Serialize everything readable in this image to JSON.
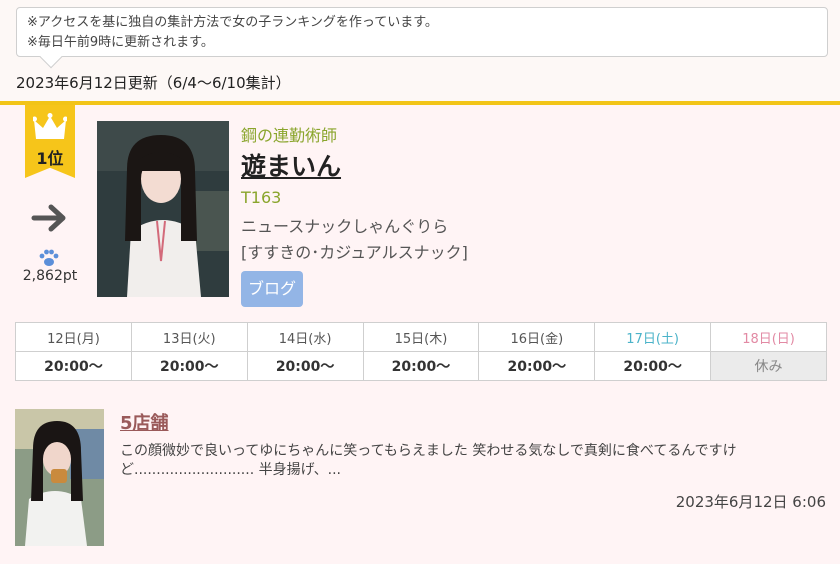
{
  "notice": {
    "line1": "※アクセスを基に独自の集計方法で女の子ランキングを作っています。",
    "line2": "※毎日午前9時に更新されます。"
  },
  "update_text": "2023年6月12日更新（6/4〜6/10集計）",
  "ranking": {
    "rank_label": "1位",
    "trend": "right-arrow-icon",
    "points": "2,862pt",
    "catchphrase": "鋼の連勤術師",
    "name": "遊まいん",
    "height": "T163",
    "shop": "ニュースナックしゃんぐりら",
    "area": "[すすきの･カジュアルスナック]",
    "blog_label": "ブログ"
  },
  "schedule": {
    "days": [
      "12日(月)",
      "13日(火)",
      "14日(水)",
      "15日(木)",
      "16日(金)",
      "17日(土)",
      "18日(日)"
    ],
    "times": [
      "20:00〜",
      "20:00〜",
      "20:00〜",
      "20:00〜",
      "20:00〜",
      "20:00〜",
      "休み"
    ]
  },
  "post": {
    "title": "5店舗",
    "body": "この顔微妙で良いってゆにちゃんに笑ってもらえました 笑わせる気なしで真剣に食べてるんですけど........................... 半身揚げ、...",
    "date": "2023年6月12日 6:06"
  },
  "colors": {
    "accent_gold": "#f6c51a",
    "catch_green": "#8aa52c",
    "blog_blue": "#93b5e6",
    "saturday": "#4bb3c9",
    "sunday": "#e28aa4"
  }
}
